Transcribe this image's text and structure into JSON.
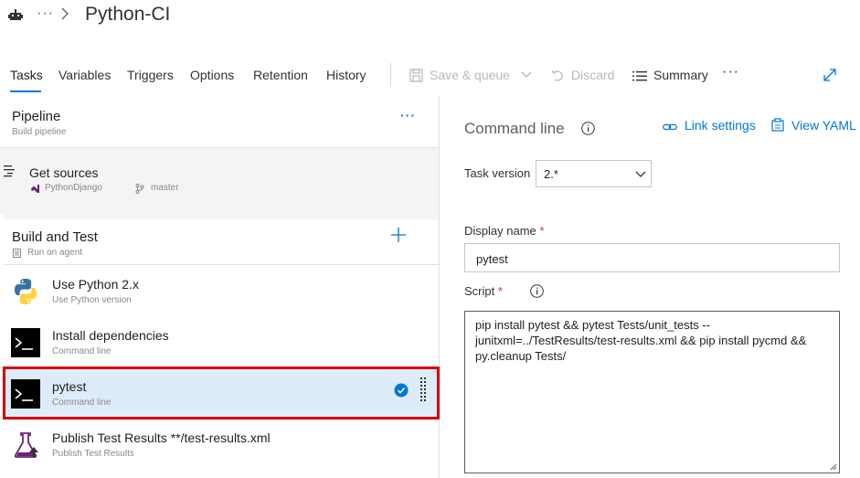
{
  "header": {
    "more_crumbs": "···",
    "title": "Python-CI"
  },
  "tabs": [
    {
      "label": "Tasks",
      "active": true
    },
    {
      "label": "Variables"
    },
    {
      "label": "Triggers"
    },
    {
      "label": "Options"
    },
    {
      "label": "Retention"
    },
    {
      "label": "History"
    }
  ],
  "toolbar": {
    "save_queue": "Save & queue",
    "discard": "Discard",
    "summary": "Summary",
    "more": "···"
  },
  "pipeline": {
    "title": "Pipeline",
    "subtitle": "Build pipeline",
    "more": "···"
  },
  "get_sources": {
    "title": "Get sources",
    "repo": "PythonDjango",
    "branch": "master"
  },
  "phase": {
    "title": "Build and Test",
    "subtitle": "Run on agent"
  },
  "tasks": [
    {
      "title": "Use Python 2.x",
      "subtitle": "Use Python version"
    },
    {
      "title": "Install dependencies",
      "subtitle": "Command line"
    },
    {
      "title": "pytest",
      "subtitle": "Command line",
      "selected": true
    },
    {
      "title": "Publish Test Results **/test-results.xml",
      "subtitle": "Publish Test Results"
    }
  ],
  "detail": {
    "title": "Command line",
    "link_settings": "Link settings",
    "view_yaml": "View YAML",
    "task_version_label": "Task version",
    "task_version_value": "2.*",
    "display_name_label": "Display name",
    "display_name_value": "pytest",
    "script_label": "Script",
    "required_mark": "*",
    "script_value": "pip install pytest && pytest Tests/unit_tests --junitxml=../TestResults/test-results.xml && pip install pycmd && py.cleanup Tests/"
  },
  "colors": {
    "accent": "#0078d4",
    "selected_bg": "#deecf9",
    "highlight_border": "#d30000"
  }
}
